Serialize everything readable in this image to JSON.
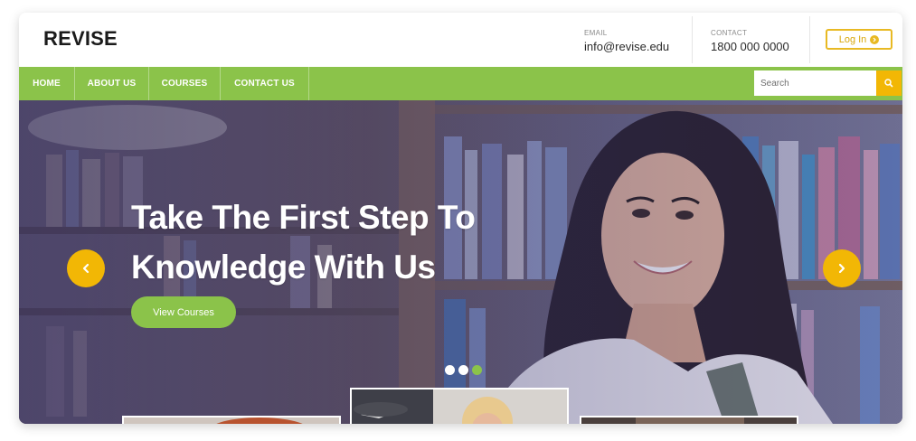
{
  "header": {
    "logo": "REVISE",
    "email_label": "EMAIL",
    "email_value": "info@revise.edu",
    "contact_label": "CONTACT",
    "contact_value": "1800 000 0000",
    "login_label": "Log In"
  },
  "nav": {
    "items": [
      {
        "label": "HOME"
      },
      {
        "label": "ABOUT US"
      },
      {
        "label": "COURSES"
      },
      {
        "label": "CONTACT US"
      }
    ],
    "search_placeholder": "Search"
  },
  "hero": {
    "title_line1": "Take The First Step To",
    "title_line2": "Knowledge With Us",
    "cta_label": "View Courses",
    "slides_total": 3,
    "active_slide": 3
  },
  "colors": {
    "accent_green": "#8bc34a",
    "accent_yellow": "#f2b705"
  }
}
